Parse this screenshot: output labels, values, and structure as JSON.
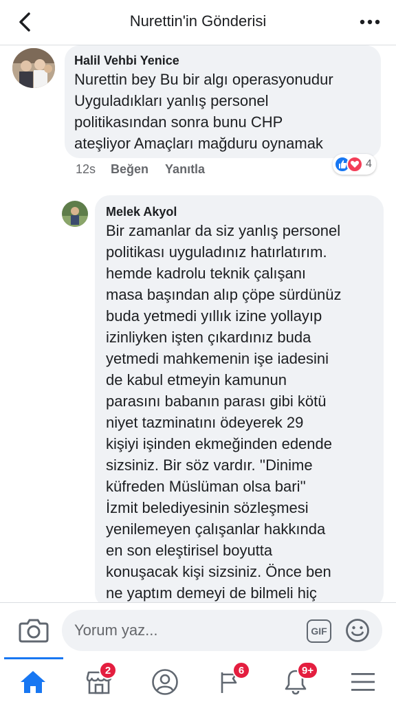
{
  "header": {
    "title": "Nurettin'in Gönderisi",
    "back_icon": "chevron-left-icon",
    "more_icon": "more-horizontal-icon"
  },
  "comments": [
    {
      "author": "Halil Vehbi Yenice",
      "text": "Nurettin bey Bu bir algı operasyonudur\nUyguladıkları yanlış personel\npolitikasından sonra bunu CHP\nateşliyor Amaçları mağduru oynamak",
      "time": "12s",
      "like_label": "Beğen",
      "reply_label": "Yanıtla",
      "reaction_count": "4",
      "reactions": [
        "like-icon",
        "love-icon"
      ]
    },
    {
      "author": "Melek Akyol",
      "text": "Bir zamanlar da siz yanlış personel\npolitikası uyguladınız hatırlatırım.\nhemde kadrolu teknik çalışanı\nmasa başından alıp çöpe sürdünüz\nbuda yetmedi yıllık izine yollayıp\nizinliyken işten çıkardınız buda\nyetmedi mahkemenin işe iadesini\nde kabul etmeyin kamunun\nparasını babanın parası gibi kötü\nniyet tazminatını ödeyerek 29\nkişiyi işinden ekmeğinden edende\nsizsiniz. Bir söz vardır. ''Dinime\nküfreden Müslüman olsa bari''\nİzmit belediyesinin sözleşmesi\nyenilemeyen çalışanlar hakkında\nen son eleştirisel boyutta\nkonuşacak kişi sizsiniz. Önce ben\nne yaptım demeyi de bilmeli hiç"
    }
  ],
  "composer": {
    "placeholder": "Yorum yaz...",
    "gif_label": "GIF",
    "camera_icon": "camera-icon",
    "emoji_icon": "emoji-icon"
  },
  "nav": {
    "items": [
      {
        "icon": "home-icon",
        "badge": ""
      },
      {
        "icon": "marketplace-icon",
        "badge": "2"
      },
      {
        "icon": "profile-icon",
        "badge": ""
      },
      {
        "icon": "groups-icon",
        "badge": "6"
      },
      {
        "icon": "bell-icon",
        "badge": "9+"
      },
      {
        "icon": "menu-icon",
        "badge": ""
      }
    ]
  },
  "colors": {
    "accent": "#1877f2",
    "badge": "#e41e3f",
    "bubble": "#f0f2f5"
  }
}
